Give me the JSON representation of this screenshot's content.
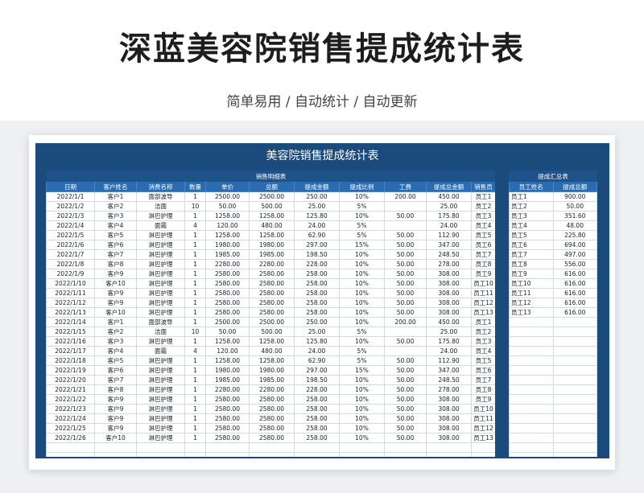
{
  "page": {
    "title": "深蓝美容院销售提成统计表",
    "subtitle": "简单易用 / 自动统计 / 自动更新"
  },
  "sheet": {
    "title": "美容院销售提成统计表",
    "detail": {
      "caption": "销售明细表",
      "headers": [
        "日期",
        "客户姓名",
        "消费名称",
        "数量",
        "单价",
        "总额",
        "提成金额",
        "提成比例",
        "工费",
        "提成总金额",
        "销售员"
      ],
      "rows": [
        [
          "2022/1/1",
          "客户1",
          "面部波导",
          "1",
          "2500.00",
          "2500.00",
          "250.00",
          "10%",
          "200.00",
          "450.00",
          "员工1"
        ],
        [
          "2022/1/2",
          "客户2",
          "洁面",
          "10",
          "50.00",
          "500.00",
          "25.00",
          "5%",
          "",
          "25.00",
          "员工2"
        ],
        [
          "2022/1/3",
          "客户3",
          "淋巴护理",
          "1",
          "1258.00",
          "1258.00",
          "125.80",
          "10%",
          "50.00",
          "175.80",
          "员工3"
        ],
        [
          "2022/1/4",
          "客户4",
          "面霜",
          "4",
          "120.00",
          "480.00",
          "24.00",
          "5%",
          "",
          "24.00",
          "员工4"
        ],
        [
          "2022/1/5",
          "客户5",
          "淋巴护理",
          "1",
          "1258.00",
          "1258.00",
          "62.90",
          "5%",
          "50.00",
          "112.90",
          "员工5"
        ],
        [
          "2022/1/6",
          "客户6",
          "淋巴护理",
          "1",
          "1980.00",
          "1980.00",
          "297.00",
          "15%",
          "50.00",
          "347.00",
          "员工6"
        ],
        [
          "2022/1/7",
          "客户7",
          "淋巴护理",
          "1",
          "1985.00",
          "1985.00",
          "198.50",
          "10%",
          "50.00",
          "248.50",
          "员工7"
        ],
        [
          "2022/1/8",
          "客户8",
          "淋巴护理",
          "1",
          "2280.00",
          "2280.00",
          "228.00",
          "10%",
          "50.00",
          "278.00",
          "员工8"
        ],
        [
          "2022/1/9",
          "客户9",
          "淋巴护理",
          "1",
          "2580.00",
          "2580.00",
          "258.00",
          "10%",
          "50.00",
          "308.00",
          "员工9"
        ],
        [
          "2022/1/10",
          "客户10",
          "淋巴护理",
          "1",
          "2580.00",
          "2580.00",
          "258.00",
          "10%",
          "50.00",
          "308.00",
          "员工10"
        ],
        [
          "2022/1/11",
          "客户9",
          "淋巴护理",
          "1",
          "2580.00",
          "2580.00",
          "258.00",
          "10%",
          "50.00",
          "308.00",
          "员工11"
        ],
        [
          "2022/1/12",
          "客户9",
          "淋巴护理",
          "1",
          "2580.00",
          "2580.00",
          "258.00",
          "10%",
          "50.00",
          "308.00",
          "员工12"
        ],
        [
          "2022/1/13",
          "客户10",
          "淋巴护理",
          "1",
          "2580.00",
          "2580.00",
          "258.00",
          "10%",
          "50.00",
          "308.00",
          "员工13"
        ],
        [
          "2022/1/14",
          "客户1",
          "面部波导",
          "1",
          "2500.00",
          "2500.00",
          "250.00",
          "10%",
          "200.00",
          "450.00",
          "员工1"
        ],
        [
          "2022/1/15",
          "客户2",
          "洁面",
          "10",
          "50.00",
          "500.00",
          "25.00",
          "5%",
          "",
          "25.00",
          "员工2"
        ],
        [
          "2022/1/16",
          "客户3",
          "淋巴护理",
          "1",
          "1258.00",
          "1258.00",
          "125.80",
          "10%",
          "50.00",
          "175.80",
          "员工3"
        ],
        [
          "2022/1/17",
          "客户4",
          "面霜",
          "4",
          "120.00",
          "480.00",
          "24.00",
          "5%",
          "",
          "24.00",
          "员工4"
        ],
        [
          "2022/1/18",
          "客户5",
          "淋巴护理",
          "1",
          "1258.00",
          "1258.00",
          "62.90",
          "5%",
          "50.00",
          "112.90",
          "员工5"
        ],
        [
          "2022/1/19",
          "客户6",
          "淋巴护理",
          "1",
          "1980.00",
          "1980.00",
          "297.00",
          "15%",
          "50.00",
          "347.00",
          "员工6"
        ],
        [
          "2022/1/20",
          "客户7",
          "淋巴护理",
          "1",
          "1985.00",
          "1985.00",
          "198.50",
          "10%",
          "50.00",
          "248.50",
          "员工7"
        ],
        [
          "2022/1/21",
          "客户8",
          "淋巴护理",
          "1",
          "2280.00",
          "2280.00",
          "228.00",
          "10%",
          "50.00",
          "278.00",
          "员工8"
        ],
        [
          "2022/1/22",
          "客户9",
          "淋巴护理",
          "1",
          "2580.00",
          "2580.00",
          "258.00",
          "10%",
          "50.00",
          "308.00",
          "员工9"
        ],
        [
          "2022/1/23",
          "客户9",
          "淋巴护理",
          "1",
          "2580.00",
          "2580.00",
          "258.00",
          "10%",
          "50.00",
          "308.00",
          "员工10"
        ],
        [
          "2022/1/24",
          "客户9",
          "淋巴护理",
          "1",
          "2580.00",
          "2580.00",
          "258.00",
          "10%",
          "50.00",
          "308.00",
          "员工11"
        ],
        [
          "2022/1/25",
          "客户9",
          "淋巴护理",
          "1",
          "2580.00",
          "2580.00",
          "258.00",
          "10%",
          "50.00",
          "308.00",
          "员工12"
        ],
        [
          "2022/1/26",
          "客户10",
          "淋巴护理",
          "1",
          "2580.00",
          "2580.00",
          "258.00",
          "10%",
          "50.00",
          "308.00",
          "员工13"
        ]
      ]
    },
    "summary": {
      "caption": "提成汇总表",
      "headers": [
        "员工姓名",
        "提成总额"
      ],
      "rows": [
        [
          "员工1",
          "900.00"
        ],
        [
          "员工2",
          "50.00"
        ],
        [
          "员工3",
          "351.60"
        ],
        [
          "员工4",
          "48.00"
        ],
        [
          "员工5",
          "225.80"
        ],
        [
          "员工6",
          "694.00"
        ],
        [
          "员工7",
          "497.00"
        ],
        [
          "员工8",
          "556.00"
        ],
        [
          "员工9",
          "616.00"
        ],
        [
          "员工10",
          "616.00"
        ],
        [
          "员工11",
          "616.00"
        ],
        [
          "员工12",
          "616.00"
        ],
        [
          "员工13",
          "616.00"
        ]
      ]
    }
  },
  "colors": {
    "frame": "#1b4a7c",
    "header": "#2b6bb0"
  }
}
